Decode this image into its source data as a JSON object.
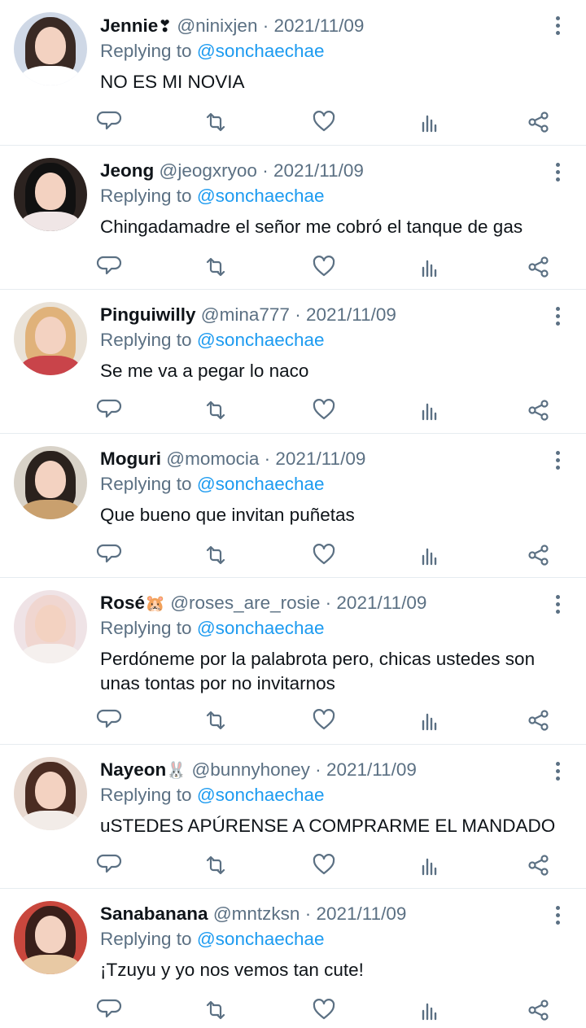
{
  "reply_prefix": "Replying to",
  "reply_target": "@sonchaechae",
  "date": "2021/11/09",
  "separator": "·",
  "accent_color": "#1d9bf0",
  "icon_names": [
    "reply-icon",
    "retweet-icon",
    "like-icon",
    "analytics-icon",
    "share-icon",
    "more-options-icon"
  ],
  "tweets": [
    {
      "name": "Jennie",
      "emoji": "❣",
      "handle": "@ninixjen",
      "text": "NO ES MI NOVIA"
    },
    {
      "name": "Jeong",
      "emoji": "",
      "handle": "@jeogxryoo",
      "text": "Chingadamadre el señor me cobró el tanque de gas"
    },
    {
      "name": "Pinguiwilly",
      "emoji": "",
      "handle": "@mina777",
      "text": "Se me va a pegar lo naco"
    },
    {
      "name": "Moguri",
      "emoji": "",
      "handle": "@momocia",
      "text": "Que bueno que invitan puñetas"
    },
    {
      "name": "Rosé",
      "emoji": "🐹",
      "handle": "@roses_are_rosie",
      "text": "Perdóneme por la palabrota pero, chicas ustedes son unas tontas por no invitarnos"
    },
    {
      "name": "Nayeon",
      "emoji": "🐰",
      "handle": "@bunnyhoney",
      "text": "uSTEDES APÚRENSE A COMPRARME EL MANDADO"
    },
    {
      "name": "Sanabanana",
      "emoji": "",
      "handle": "@mntzksn",
      "text": "¡Tzuyu y yo nos vemos tan cute!"
    }
  ]
}
